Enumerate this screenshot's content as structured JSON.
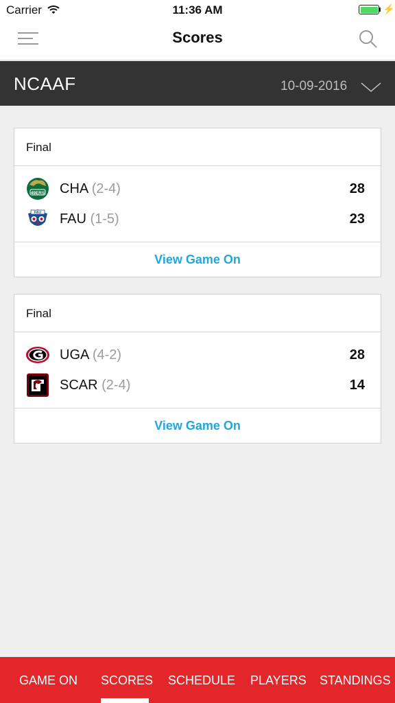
{
  "status_bar": {
    "carrier": "Carrier",
    "time": "11:36 AM"
  },
  "nav": {
    "title": "Scores",
    "menu_icon": "hamburger-menu-icon",
    "search_icon": "search-icon"
  },
  "league_bar": {
    "league": "NCAAF",
    "date": "10-09-2016",
    "dropdown_icon": "chevron-down-icon"
  },
  "games": [
    {
      "status": "Final",
      "teams": [
        {
          "abbr": "CHA",
          "record": "(2-4)",
          "score": "28",
          "logo_icon": "charlotte-49ers-logo"
        },
        {
          "abbr": "FAU",
          "record": "(1-5)",
          "score": "23",
          "logo_icon": "fau-owls-logo"
        }
      ],
      "link_label": "View Game On"
    },
    {
      "status": "Final",
      "teams": [
        {
          "abbr": "UGA",
          "record": "(4-2)",
          "score": "28",
          "logo_icon": "georgia-bulldogs-logo"
        },
        {
          "abbr": "SCAR",
          "record": "(2-4)",
          "score": "14",
          "logo_icon": "south-carolina-gamecocks-logo"
        }
      ],
      "link_label": "View Game On"
    }
  ],
  "tabs": {
    "items": [
      {
        "label": "GAME ON"
      },
      {
        "label": "SCORES"
      },
      {
        "label": "SCHEDULE"
      },
      {
        "label": "PLAYERS"
      },
      {
        "label": "STANDINGS"
      }
    ],
    "active": "SCORES"
  },
  "colors": {
    "accent": "#e3262a",
    "link": "#1ea7e1",
    "league_bar": "#333333",
    "record": "#9b9b9b"
  }
}
